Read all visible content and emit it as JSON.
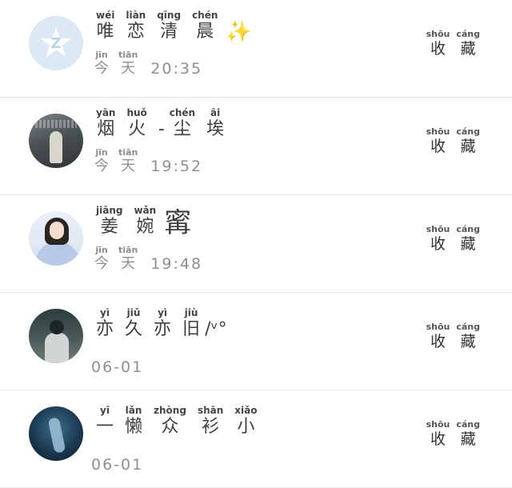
{
  "contacts": [
    {
      "name": [
        {
          "py": "wéi",
          "hz": "唯"
        },
        {
          "py": "liàn",
          "hz": "恋"
        },
        {
          "py": "qīng",
          "hz": "清"
        },
        {
          "py": "chén",
          "hz": "晨"
        }
      ],
      "name_suffix": "✨",
      "time_label": [
        {
          "py": "jīn",
          "hz": "今"
        },
        {
          "py": "tiān",
          "hz": "天"
        }
      ],
      "time": "20:35",
      "action": [
        {
          "py": "shōu",
          "hz": "收"
        },
        {
          "py": "cáng",
          "hz": "藏"
        }
      ]
    },
    {
      "name": [
        {
          "py": "yān",
          "hz": "烟"
        },
        {
          "py": "huǒ",
          "hz": "火"
        },
        {
          "py": "",
          "hz": "-"
        },
        {
          "py": "chén",
          "hz": "尘"
        },
        {
          "py": "āi",
          "hz": "埃"
        }
      ],
      "time_label": [
        {
          "py": "jīn",
          "hz": "今"
        },
        {
          "py": "tiān",
          "hz": "天"
        }
      ],
      "time": "19:52",
      "action": [
        {
          "py": "shōu",
          "hz": "收"
        },
        {
          "py": "cáng",
          "hz": "藏"
        }
      ]
    },
    {
      "name": [
        {
          "py": "jiāng",
          "hz": "姜"
        },
        {
          "py": "wǎn",
          "hz": "婉"
        }
      ],
      "name_big": "寗",
      "time_label": [
        {
          "py": "jīn",
          "hz": "今"
        },
        {
          "py": "tiān",
          "hz": "天"
        }
      ],
      "time": "19:48",
      "action": [
        {
          "py": "shōu",
          "hz": "收"
        },
        {
          "py": "cáng",
          "hz": "藏"
        }
      ]
    },
    {
      "name": [
        {
          "py": "yì",
          "hz": "亦"
        },
        {
          "py": "jiǔ",
          "hz": "久"
        },
        {
          "py": "yì",
          "hz": "亦"
        },
        {
          "py": "jiù",
          "hz": "旧"
        }
      ],
      "name_suffix": "/ᵛ°",
      "date": "06-01",
      "action": [
        {
          "py": "shōu",
          "hz": "收"
        },
        {
          "py": "cáng",
          "hz": "藏"
        }
      ]
    },
    {
      "name": [
        {
          "py": "yī",
          "hz": "一"
        },
        {
          "py": "lǎn",
          "hz": "懒"
        },
        {
          "py": "zhòng",
          "hz": "众"
        },
        {
          "py": "shān",
          "hz": "衫"
        },
        {
          "py": "xiǎo",
          "hz": "小"
        }
      ],
      "date": "06-01",
      "action": [
        {
          "py": "shōu",
          "hz": "收"
        },
        {
          "py": "cáng",
          "hz": "藏"
        }
      ]
    }
  ]
}
